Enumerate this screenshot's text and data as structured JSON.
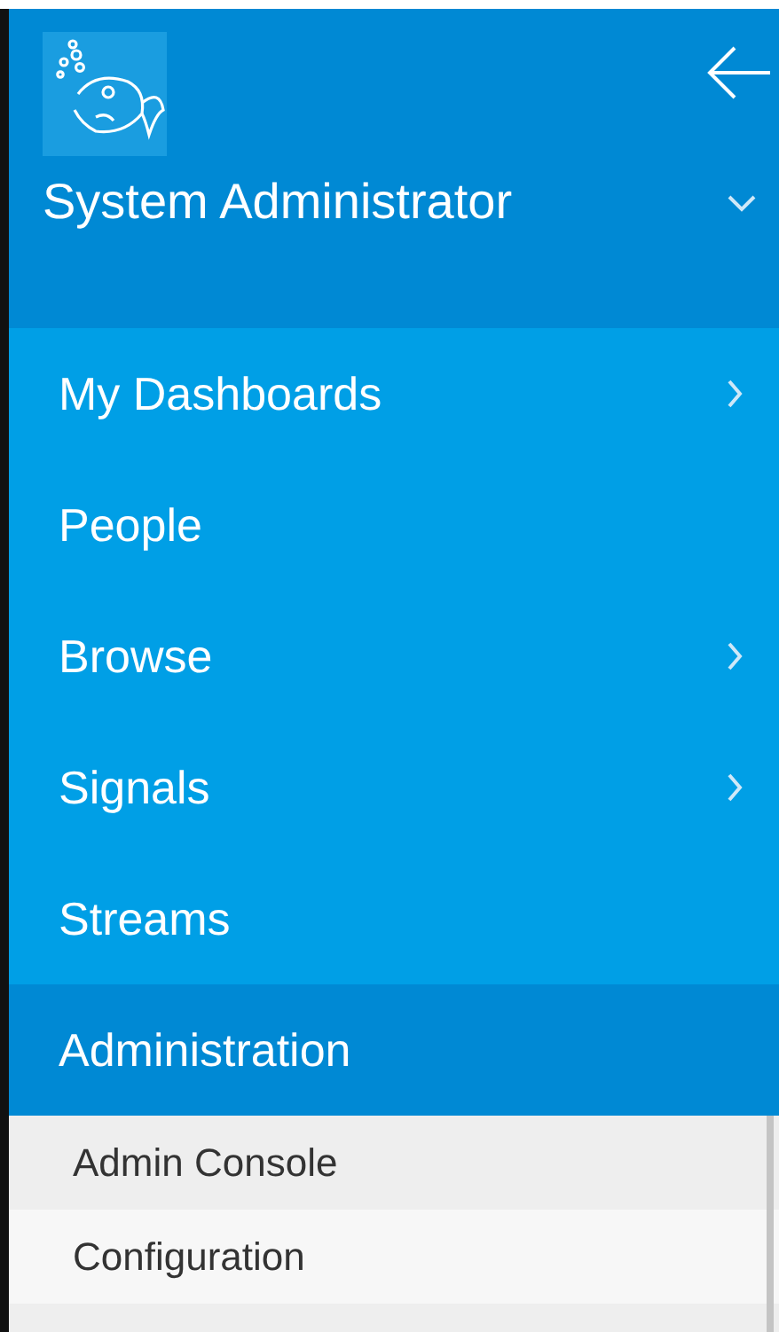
{
  "profile": {
    "name": "System Administrator"
  },
  "menu": [
    {
      "label": "My Dashboards",
      "has_submenu": true,
      "selected": false
    },
    {
      "label": "People",
      "has_submenu": false,
      "selected": false
    },
    {
      "label": "Browse",
      "has_submenu": true,
      "selected": false
    },
    {
      "label": "Signals",
      "has_submenu": true,
      "selected": false
    },
    {
      "label": "Streams",
      "has_submenu": false,
      "selected": false
    },
    {
      "label": "Administration",
      "has_submenu": false,
      "selected": true
    }
  ],
  "submenu": [
    {
      "label": "Admin Console"
    },
    {
      "label": "Configuration"
    }
  ]
}
